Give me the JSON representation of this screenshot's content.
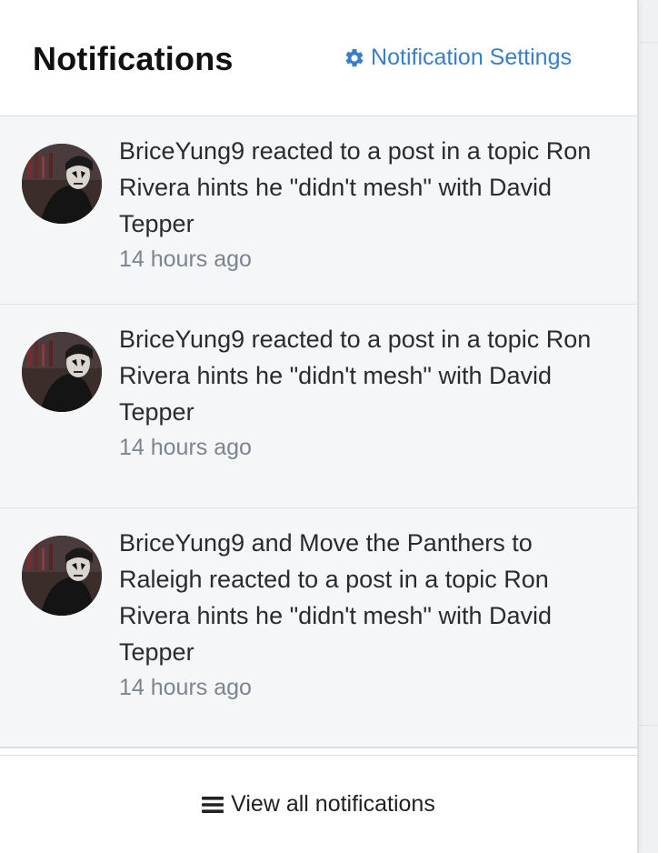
{
  "header": {
    "title": "Notifications",
    "settings_label": "Notification Settings",
    "settings_icon": "gear-icon"
  },
  "notifications": [
    {
      "text": "BriceYung9 reacted to a post in a topic Ron Rivera hints he \"didn't mesh\" with David Tepper",
      "time": "14 hours ago",
      "avatar": "avatar-icon"
    },
    {
      "text": "BriceYung9 reacted to a post in a topic Ron Rivera hints he \"didn't mesh\" with David Tepper",
      "time": "14 hours ago",
      "avatar": "avatar-icon"
    },
    {
      "text": "BriceYung9 and Move the Panthers to Raleigh reacted to a post in a topic Ron Rivera hints he \"didn't mesh\" with David Tepper",
      "time": "14 hours ago",
      "avatar": "avatar-icon"
    }
  ],
  "footer": {
    "view_all_label": "View all notifications",
    "view_all_icon": "menu-icon"
  },
  "colors": {
    "link": "#3a7fc4",
    "timestamp": "#7b8590",
    "item_bg": "#f5f6f8"
  }
}
